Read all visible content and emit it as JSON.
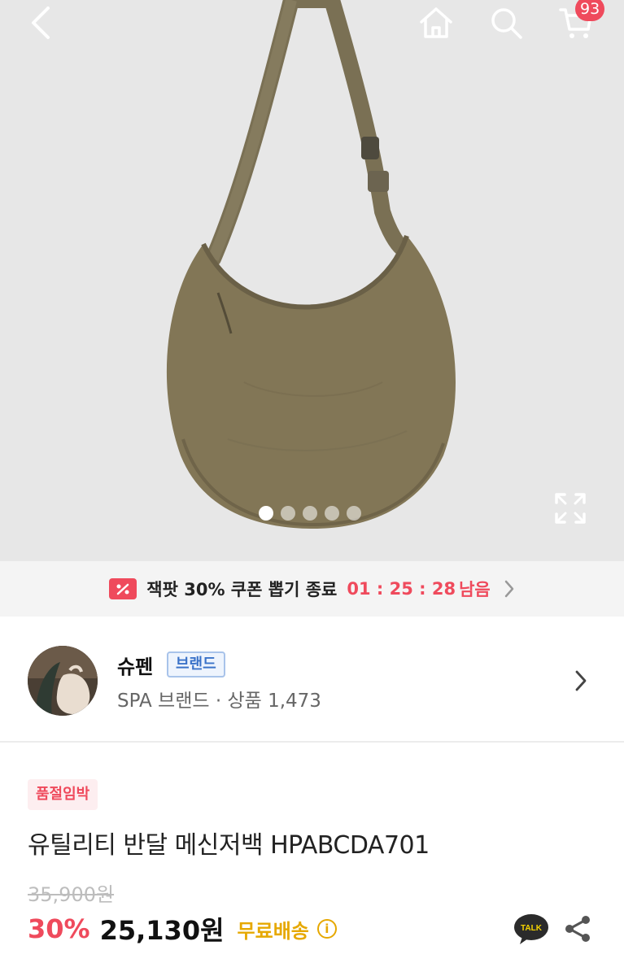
{
  "header": {
    "back_icon": "chevron-left-icon",
    "home_icon": "home-icon",
    "search_icon": "search-icon",
    "cart_icon": "cart-icon",
    "cart_count": "93"
  },
  "gallery": {
    "total_images": 5,
    "active_index": 0,
    "expand_icon": "expand-icon"
  },
  "coupon": {
    "text": "잭팟 30% 쿠폰 뽑기 종료",
    "timer": "01 : 25 : 28",
    "remain_label": "남음",
    "accent_color": "#ef4a5c"
  },
  "brand": {
    "name": "슈펜",
    "badge": "브랜드",
    "meta": "SPA 브랜드 · 상품 1,473"
  },
  "product": {
    "badge": "품절임박",
    "title": "유틸리티 반달 메신저백 HPABCDA701",
    "original_price": "35,900원",
    "discount": "30%",
    "price": "25,130원",
    "shipping": "무료배송",
    "info_icon": "i",
    "talk_label": "TALK"
  }
}
